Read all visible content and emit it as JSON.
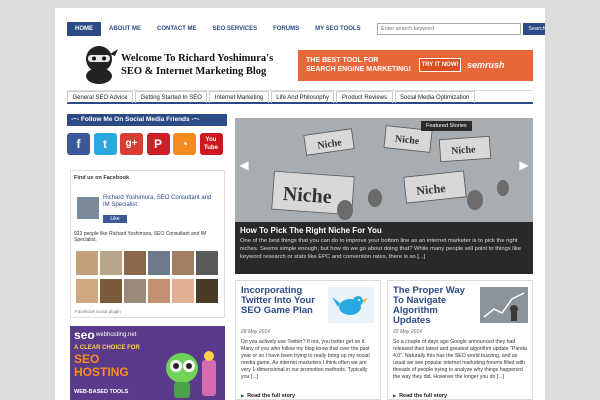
{
  "topnav": {
    "items": [
      "HOME",
      "ABOUT ME",
      "CONTACT ME",
      "SEO SERVICES",
      "FORUMS",
      "MY SEO TOOLS"
    ]
  },
  "search": {
    "placeholder": "Enter search keyword",
    "button": "Search"
  },
  "header": {
    "title_line1": "Welcome To Richard Yoshimura's",
    "title_line2": "SEO & Internet Marketing Blog"
  },
  "ad": {
    "line1": "THE BEST TOOL FOR",
    "line2": "SEARCH ENGINE MARKETING!",
    "cta": "TRY IT NOW!",
    "brand": "semrush"
  },
  "catnav": {
    "items": [
      "General SEO Advice",
      "Getting Started In SEO",
      "Internet Marketing",
      "Life And Philosophy",
      "Product Reviews",
      "Social Media Optimization"
    ]
  },
  "sidebar": {
    "follow_title": "-~- Follow Me On Social Media Friends -~-",
    "socials": [
      {
        "glyph": "f",
        "color": "#3b5998"
      },
      {
        "glyph": "t",
        "color": "#2aa9e0"
      },
      {
        "glyph": "g+",
        "color": "#d73d32"
      },
      {
        "glyph": "P",
        "color": "#cb2027"
      },
      {
        "glyph": "◔",
        "color": "#f38b1e"
      },
      {
        "glyph": "You Tube",
        "color": "#cc181e"
      }
    ],
    "fb": {
      "header": "Find us on Facebook",
      "page_name": "Richard Yoshimura, SEO Consultant and IM Specialist",
      "like": "Like",
      "count_text": "923 people like Richard Yoshimura, SEO Consultant and IM Specialist.",
      "plugin": "Facebook social plugin"
    },
    "banner": {
      "brand": "seo",
      "domain": "webhosting.net",
      "tagline": "A CLEAR CHOICE FOR",
      "big": "SEO HOSTING",
      "tail": "WEB-BASED TOOLS"
    }
  },
  "featured": {
    "label": "Featured Stories",
    "title": "How To Pick The Right Niche For You",
    "excerpt": "One of the best things that you can do to improve your bottom line as an internet marketer is to pick the right niches. Seems simple enough, but how do we go about doing that? While many people will point to things like keyword research or stats like EPC and conversion rates, there is so [...]"
  },
  "posts": [
    {
      "title": "Incorporating Twitter Into Your SEO Game Plan",
      "date": "28 May 2014",
      "body": "Do you actively use Twitter? If not, you better get on it. Many of you who follow my blog know that over the past year or so I have been trying to really bring up my social media game. As internet marketers I think often we are very 1-dimensional in our promotion methods. Typically you [...]",
      "readmore": "Read the full story"
    },
    {
      "title": "The Proper Way To Navigate Algorithm Updates",
      "date": "23 May 2014",
      "body": "So a couple of days ago Google announced they had released their latest and greatest algorithm update \"Panda 4.0\". Naturally this has the SEO world buzzing, and as usual we see popular internet marketing forums filled with threads of people trying to analyze why things happened the way they did. However the longer you do [...]",
      "readmore": "Read the full story"
    }
  ]
}
